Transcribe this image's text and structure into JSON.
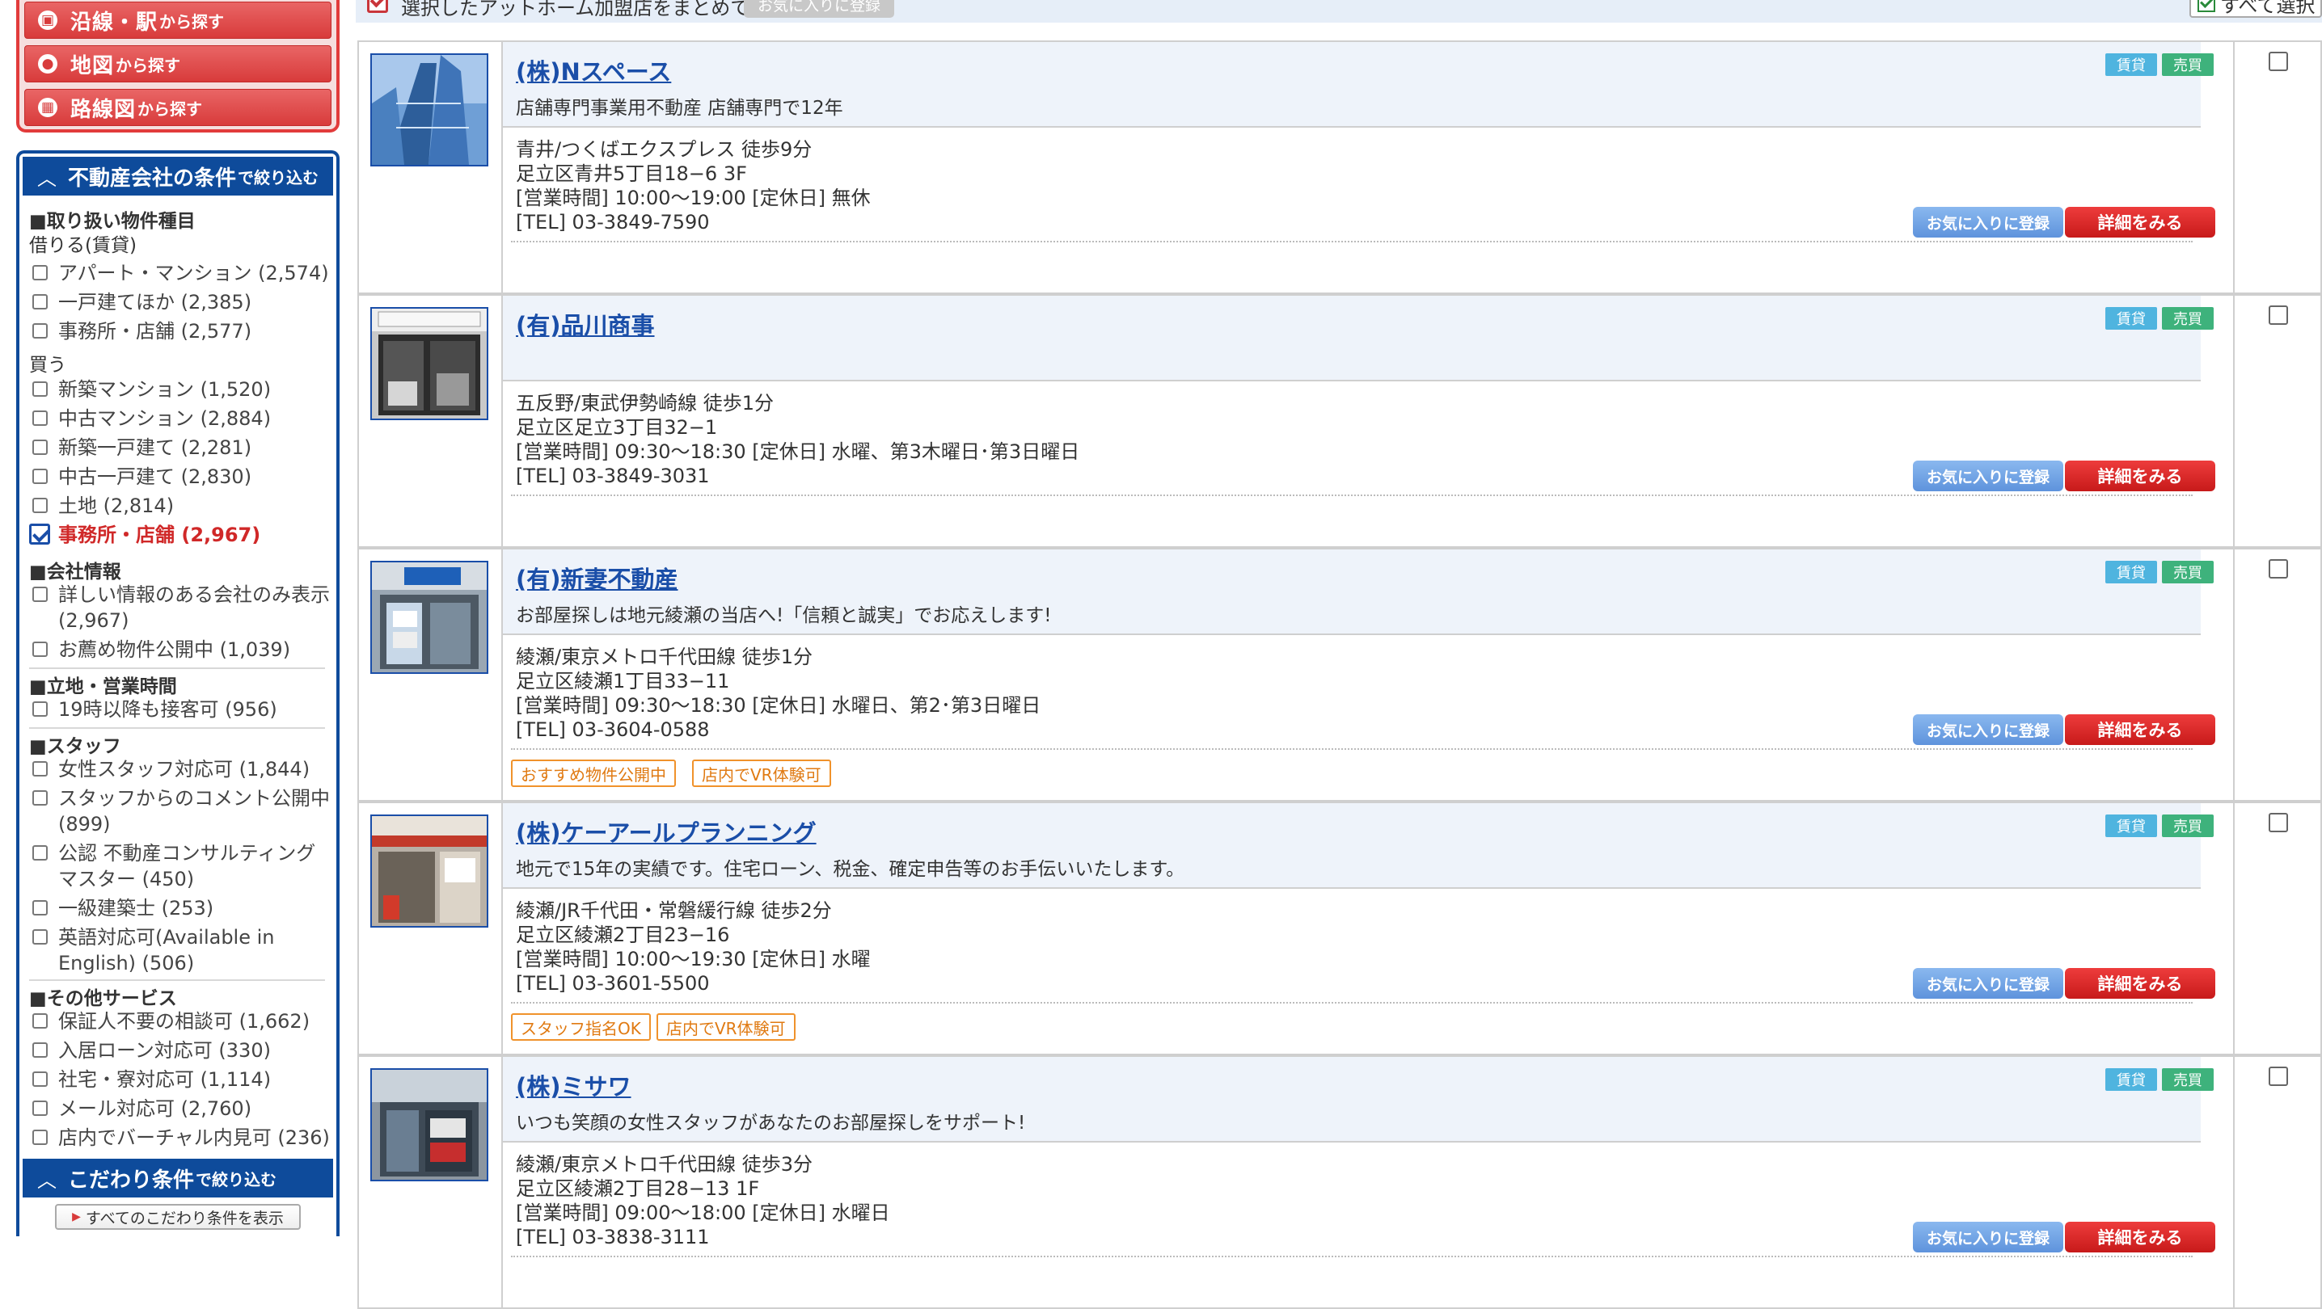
{
  "sidebar": {
    "search_buttons": [
      {
        "big": "沿線・駅",
        "small": "から探す",
        "icon": "train-icon"
      },
      {
        "big": "地図",
        "small": "から探す",
        "icon": "map-pin-icon"
      },
      {
        "big": "路線図",
        "small": "から探す",
        "icon": "route-map-icon"
      }
    ],
    "company_filter_title": {
      "big": "不動産会社の条件",
      "small": "で絞り込む"
    },
    "property_types": {
      "heading": "■取り扱い物件種目",
      "rent_label": "借りる(賃貸)",
      "rent_items": [
        "アパート・マンション (2,574)",
        "一戸建てほか (2,385)",
        "事務所・店舗 (2,577)"
      ],
      "buy_label": "買う",
      "buy_items": [
        "新築マンション (1,520)",
        "中古マンション (2,884)",
        "新築一戸建て (2,281)",
        "中古一戸建て (2,830)",
        "土地 (2,814)",
        "事務所・店舗 (2,967)"
      ]
    },
    "company_info": {
      "heading": "■会社情報",
      "items": [
        "詳しい情報のある会社のみ表示 (2,967)",
        "お薦め物件公開中 (1,039)"
      ]
    },
    "location_hours": {
      "heading": "■立地・営業時間",
      "items": [
        "19時以降も接客可 (956)"
      ]
    },
    "staff": {
      "heading": "■スタッフ",
      "items": [
        "女性スタッフ対応可 (1,844)",
        "スタッフからのコメント公開中 (899)",
        "公認 不動産コンサルティングマスター (450)",
        "一級建築士 (253)",
        "英語対応可(Available in English) (506)"
      ]
    },
    "other_services": {
      "heading": "■その他サービス",
      "items": [
        "保証人不要の相談可 (1,662)",
        "入居ローン対応可 (330)",
        "社宅・寮対応可 (1,114)",
        "メール対応可 (2,760)",
        "店内でバーチャル内見可 (236)"
      ]
    },
    "kodawari_title": {
      "big": "こだわり条件",
      "small": "で絞り込む"
    },
    "show_all_label": "すべてのこだわり条件を表示"
  },
  "top_bar": {
    "batch_label": "選択したアットホーム加盟店をまとめて",
    "fav_button": "お気に入りに登録",
    "select_all": "すべて選択"
  },
  "common": {
    "tag_rent": "賃貸",
    "tag_sale": "売買",
    "fav_button": "お気に入りに登録",
    "detail_button": "詳細をみる"
  },
  "listings": [
    {
      "name": "(株)Nスペース",
      "catch": "店舗専門事業用不動産 店舗専門で12年",
      "access": "青井/つくばエクスプレス 徒歩9分",
      "address": "足立区青井5丁目18−6 3F",
      "hours": "[営業時間] 10:00〜19:00 [定休日] 無休",
      "tel": "[TEL] 03-3849-7590",
      "features": []
    },
    {
      "name": "(有)品川商事",
      "catch": "",
      "access": "五反野/東武伊勢崎線 徒歩1分",
      "address": "足立区足立3丁目32−1",
      "hours": "[営業時間] 09:30〜18:30 [定休日] 水曜、第3木曜日･第3日曜日",
      "tel": "[TEL] 03-3849-3031",
      "features": []
    },
    {
      "name": "(有)新妻不動産",
      "catch": "お部屋探しは地元綾瀬の当店へ!「信頼と誠実」でお応えします!",
      "access": "綾瀬/東京メトロ千代田線 徒歩1分",
      "address": "足立区綾瀬1丁目33−11",
      "hours": "[営業時間] 09:30〜18:30 [定休日] 水曜日、第2･第3日曜日",
      "tel": "[TEL] 03-3604-0588",
      "features": [
        "おすすめ物件公開中",
        "店内でVR体験可"
      ]
    },
    {
      "name": "(株)ケーアールプランニング",
      "catch": "地元で15年の実績です。住宅ローン、税金、確定申告等のお手伝いいたします。",
      "access": "綾瀬/JR千代田・常磐緩行線 徒歩2分",
      "address": "足立区綾瀬2丁目23−16",
      "hours": "[営業時間] 10:00〜19:30 [定休日] 水曜",
      "tel": "[TEL] 03-3601-5500",
      "features": [
        "スタッフ指名OK",
        "店内でVR体験可"
      ]
    },
    {
      "name": "(株)ミサワ",
      "catch": "いつも笑顔の女性スタッフがあなたのお部屋探しをサポート!",
      "access": "綾瀬/東京メトロ千代田線 徒歩3分",
      "address": "足立区綾瀬2丁目28−13 1F",
      "hours": "[営業時間] 09:00〜18:00 [定休日] 水曜日",
      "tel": "[TEL] 03-3838-3111",
      "features": []
    }
  ]
}
